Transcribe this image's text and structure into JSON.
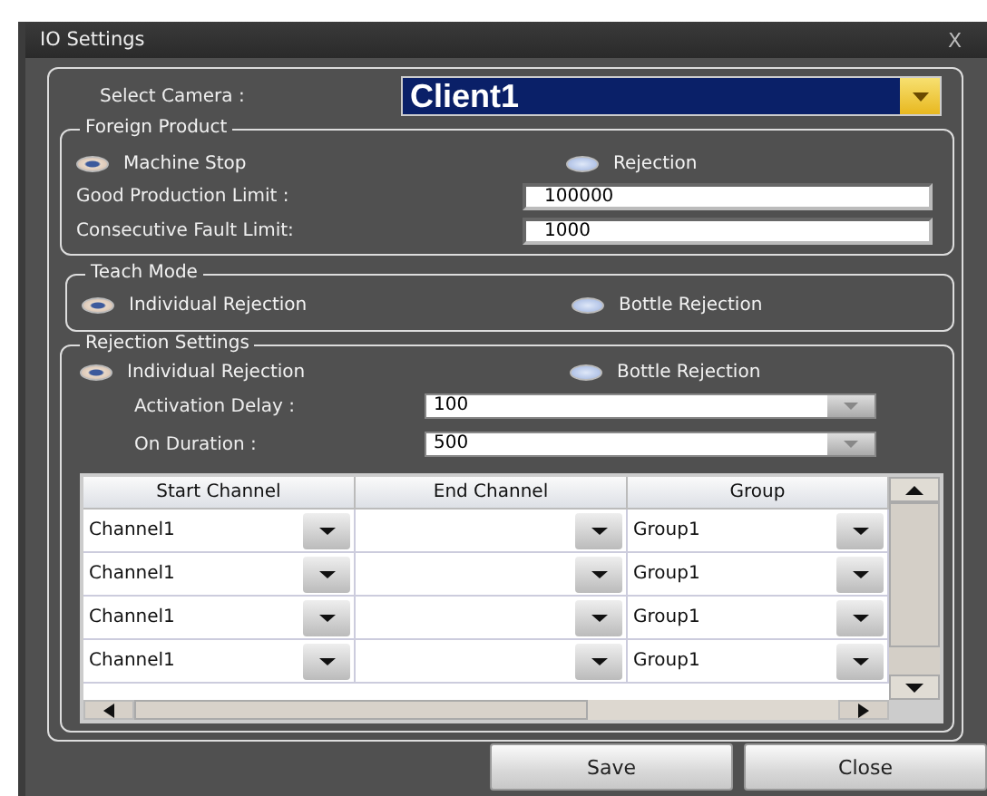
{
  "window": {
    "title": "IO Settings",
    "close": "X"
  },
  "camera": {
    "label": "Select Camera :",
    "value": "Client1"
  },
  "foreign_product": {
    "title": "Foreign Product",
    "options": [
      {
        "label": "Machine Stop",
        "selected": true
      },
      {
        "label": "Rejection",
        "selected": false
      }
    ],
    "fields": [
      {
        "label": "Good Production Limit :",
        "value": "100000"
      },
      {
        "label": "Consecutive Fault Limit:",
        "value": "1000"
      }
    ]
  },
  "teach_mode": {
    "title": "Teach Mode",
    "options": [
      {
        "label": "Individual Rejection",
        "selected": true
      },
      {
        "label": "Bottle Rejection",
        "selected": false
      }
    ]
  },
  "rejection_settings": {
    "title": "Rejection Settings",
    "options": [
      {
        "label": "Individual Rejection",
        "selected": true
      },
      {
        "label": "Bottle Rejection",
        "selected": false
      }
    ],
    "fields": [
      {
        "label": "Activation Delay :",
        "value": "100"
      },
      {
        "label": "On Duration :",
        "value": "500"
      }
    ],
    "table": {
      "columns": [
        "Start Channel",
        "End Channel",
        "Group"
      ],
      "rows": [
        {
          "start": "Channel1",
          "group": "Group1"
        },
        {
          "start": "Channel1",
          "group": "Group1"
        },
        {
          "start": "Channel1",
          "group": "Group1"
        },
        {
          "start": "Channel1",
          "group": "Group1"
        }
      ]
    }
  },
  "buttons": [
    "Save",
    "Close"
  ]
}
